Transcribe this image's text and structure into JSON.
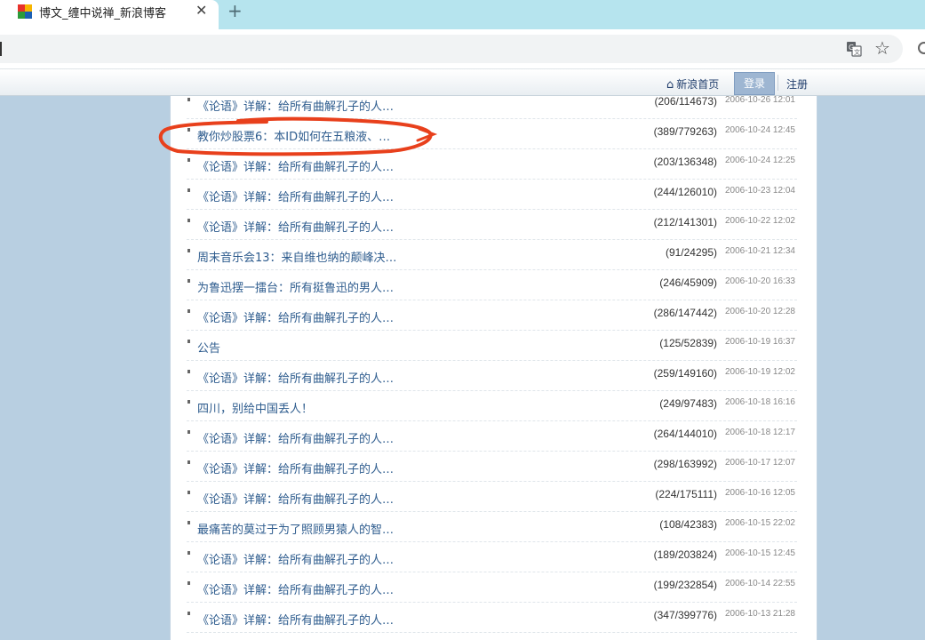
{
  "browser": {
    "tab_title": "博文_缠中说禅_新浪博客",
    "close_glyph": "✕",
    "new_tab_glyph": "+",
    "star_glyph": "☆"
  },
  "sina_bar": {
    "home_label": "新浪首页",
    "home_icon": "home-icon",
    "login_label": "登录",
    "register_label": "注册"
  },
  "articles": [
    {
      "title": "《论语》详解：给所有曲解孔子的人…",
      "stats": "(206/114673)",
      "date": "2006-10-26 12:01"
    },
    {
      "title": "教你炒股票6：本ID如何在五粮液、…",
      "stats": "(389/779263)",
      "date": "2006-10-24 12:45"
    },
    {
      "title": "《论语》详解：给所有曲解孔子的人…",
      "stats": "(203/136348)",
      "date": "2006-10-24 12:25"
    },
    {
      "title": "《论语》详解：给所有曲解孔子的人…",
      "stats": "(244/126010)",
      "date": "2006-10-23 12:04"
    },
    {
      "title": "《论语》详解：给所有曲解孔子的人…",
      "stats": "(212/141301)",
      "date": "2006-10-22 12:02"
    },
    {
      "title": "周末音乐会13：来自维也纳的颠峰决…",
      "stats": "(91/24295)",
      "date": "2006-10-21 12:34"
    },
    {
      "title": "为鲁迅摆一擂台：所有挺鲁迅的男人…",
      "stats": "(246/45909)",
      "date": "2006-10-20 16:33"
    },
    {
      "title": "《论语》详解：给所有曲解孔子的人…",
      "stats": "(286/147442)",
      "date": "2006-10-20 12:28"
    },
    {
      "title": "公告",
      "stats": "(125/52839)",
      "date": "2006-10-19 16:37"
    },
    {
      "title": "《论语》详解：给所有曲解孔子的人…",
      "stats": "(259/149160)",
      "date": "2006-10-19 12:02"
    },
    {
      "title": "四川，别给中国丢人！",
      "stats": "(249/97483)",
      "date": "2006-10-18 16:16"
    },
    {
      "title": "《论语》详解：给所有曲解孔子的人…",
      "stats": "(264/144010)",
      "date": "2006-10-18 12:17"
    },
    {
      "title": "《论语》详解：给所有曲解孔子的人…",
      "stats": "(298/163992)",
      "date": "2006-10-17 12:07"
    },
    {
      "title": "《论语》详解：给所有曲解孔子的人…",
      "stats": "(224/175111)",
      "date": "2006-10-16 12:05"
    },
    {
      "title": "最痛苦的莫过于为了照顾男猿人的智…",
      "stats": "(108/42383)",
      "date": "2006-10-15 22:02"
    },
    {
      "title": "《论语》详解：给所有曲解孔子的人…",
      "stats": "(189/203824)",
      "date": "2006-10-15 12:45"
    },
    {
      "title": "《论语》详解：给所有曲解孔子的人…",
      "stats": "(199/232854)",
      "date": "2006-10-14 22:55"
    },
    {
      "title": "《论语》详解：给所有曲解孔子的人…",
      "stats": "(347/399776)",
      "date": "2006-10-13 21:28"
    }
  ],
  "colors": {
    "page_bg": "#b8cfe1",
    "tabstrip": "#b6e4ee",
    "link": "#2e5c8e",
    "annotation": "#e8401c"
  }
}
